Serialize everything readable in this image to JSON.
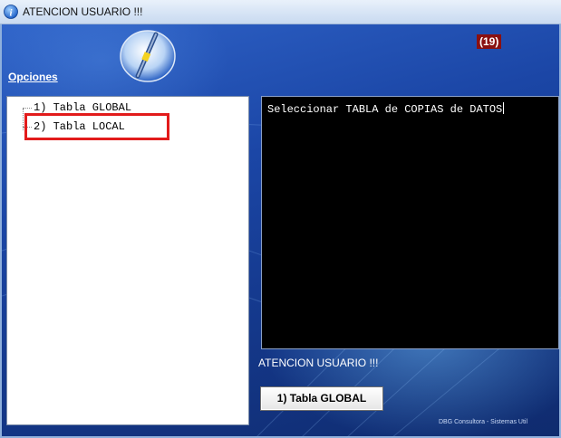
{
  "window": {
    "title": "ATENCION USUARIO !!!"
  },
  "header": {
    "options_label": "Opciones",
    "badge": "(19)"
  },
  "tree": {
    "items": [
      "1) Tabla GLOBAL",
      "2) Tabla LOCAL"
    ]
  },
  "console": {
    "text": "Seleccionar TABLA de COPIAS de DATOS"
  },
  "status": {
    "text": "ATENCION USUARIO !!!"
  },
  "action": {
    "button_label": "1) Tabla GLOBAL"
  },
  "footer": {
    "text": "DBG Consultora - Sistemas Util"
  },
  "colors": {
    "highlight": "#e21b1b",
    "badge_bg": "#8a1010",
    "panel_bg": "#1b46a6"
  },
  "icons": {
    "title": "info-icon",
    "logo": "app-logo"
  }
}
